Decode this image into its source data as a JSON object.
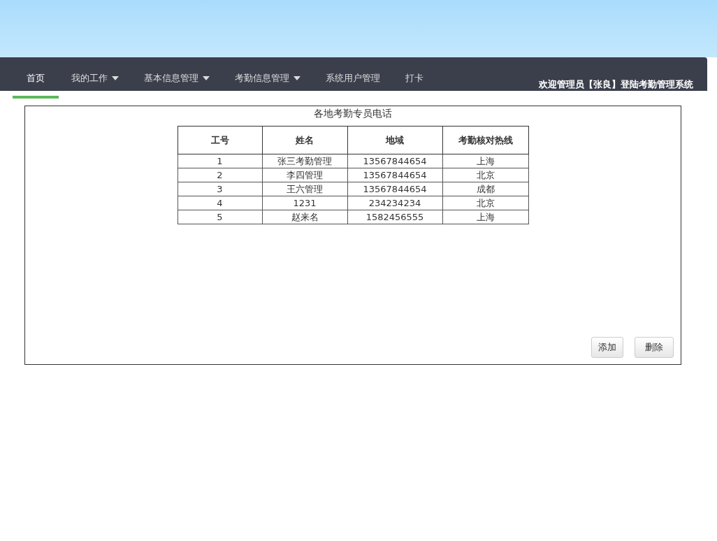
{
  "nav": {
    "tabs": [
      {
        "label": "首页",
        "selected": true,
        "has_menu": false
      },
      {
        "label": "我的工作",
        "selected": false,
        "has_menu": true
      },
      {
        "label": "基本信息管理",
        "selected": false,
        "has_menu": true
      },
      {
        "label": "考勤信息管理",
        "selected": false,
        "has_menu": true
      },
      {
        "label": "系统用户管理",
        "selected": false,
        "has_menu": false
      },
      {
        "label": "打卡",
        "selected": false,
        "has_menu": false
      }
    ],
    "welcome": "欢迎管理员【张良】登陆考勤管理系统"
  },
  "panel": {
    "title": "各地考勤专员电话",
    "table": {
      "columns": [
        "工号",
        "姓名",
        "地域",
        "考勤核对热线"
      ],
      "rows": [
        [
          "1",
          "张三考勤管理",
          "13567844654",
          "上海"
        ],
        [
          "2",
          "李四管理",
          "13567844654",
          "北京"
        ],
        [
          "3",
          "王六管理",
          "13567844654",
          "成都"
        ],
        [
          "4",
          "1231",
          "234234234",
          "北京"
        ],
        [
          "5",
          "赵来名",
          "1582456555",
          "上海"
        ]
      ]
    },
    "buttons": [
      "添加",
      "删除"
    ]
  }
}
